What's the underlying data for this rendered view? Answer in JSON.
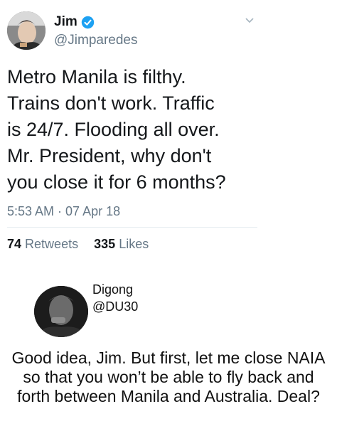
{
  "tweet": {
    "display_name": "Jim",
    "handle": "@Jimparedes",
    "text": "Metro Manila is filthy.\nTrains don't work. Traffic\nis 24/7. Flooding all over.\nMr. President, why don't\nyou close it for 6 months?",
    "timestamp": "5:53 AM · 07 Apr 18",
    "retweets_count": "74",
    "retweets_label": "Retweets",
    "likes_count": "335",
    "likes_label": "Likes",
    "icons": [
      "verified-badge-icon",
      "chevron-down-icon"
    ],
    "colors": {
      "verified": "#1da1f2",
      "secondary_text": "#657786",
      "primary_text": "#14171a"
    }
  },
  "reply": {
    "display_name": "Digong",
    "handle": "@DU30",
    "text": "Good idea, Jim. But first, let me close NAIA so that you won’t be able to fly back and forth between Manila and Australia. Deal?"
  }
}
